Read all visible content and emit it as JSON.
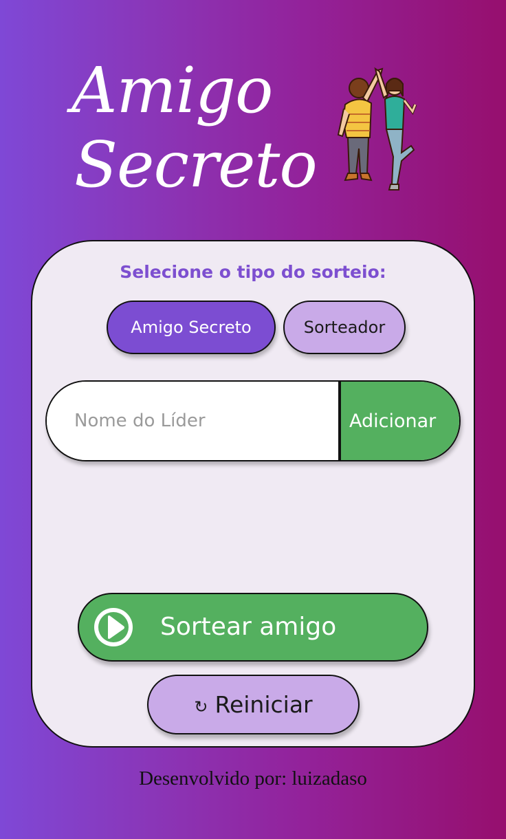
{
  "header": {
    "title_line1": "Amigo",
    "title_line2": "Secreto",
    "illustration_icon": "two-friends-high-five-illustration"
  },
  "card": {
    "draw_type_label": "Selecione o tipo do sorteio:",
    "mode_options": [
      {
        "label": "Amigo Secreto",
        "selected": true
      },
      {
        "label": "Sorteador",
        "selected": false
      }
    ],
    "name_input": {
      "value": "",
      "placeholder": "Nome do Líder"
    },
    "add_button_label": "Adicionar",
    "draw_button": {
      "label": "Sortear amigo",
      "icon": "play-circle-icon"
    },
    "reset_button": {
      "label": "Reiniciar",
      "icon": "↻"
    }
  },
  "footer": {
    "text": "Desenvolvido por: luizadaso"
  },
  "colors": {
    "accent_purple": "#7c4dd2",
    "light_purple": "#c9aae8",
    "action_green": "#54b05f",
    "card_background": "#f0eaf3"
  }
}
